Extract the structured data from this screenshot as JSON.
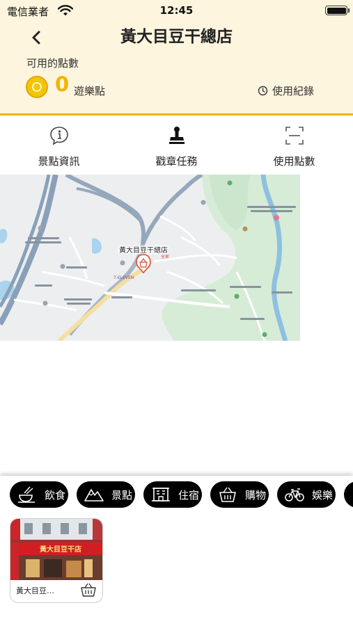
{
  "status_bar": {
    "carrier": "電信業者",
    "time": "12:45"
  },
  "header": {
    "title": "黃大目豆干總店",
    "points_label": "可用的點數",
    "points_value": "0",
    "points_unit": "遊樂點",
    "history_label": "使用紀錄"
  },
  "tabs": [
    {
      "label": "景點資訊",
      "icon": "info-icon"
    },
    {
      "label": "戳章任務",
      "icon": "stamp-icon"
    },
    {
      "label": "使用點數",
      "icon": "scan-icon"
    }
  ],
  "map": {
    "pin_label": "黃大目豆干總店",
    "labels": [
      "7-ELEVEN",
      "全家"
    ]
  },
  "categories": [
    {
      "label": "飲食",
      "icon": "food-icon"
    },
    {
      "label": "景點",
      "icon": "mountain-icon"
    },
    {
      "label": "住宿",
      "icon": "hotel-icon"
    },
    {
      "label": "購物",
      "icon": "basket-icon"
    },
    {
      "label": "娛樂",
      "icon": "bicycle-icon"
    }
  ],
  "cards": [
    {
      "name": "黃大目豆…",
      "sign_text": "黃大目豆干店"
    }
  ],
  "colors": {
    "accent": "#f2b400",
    "header_bg": "#fdf5de",
    "pill": "#000000"
  }
}
